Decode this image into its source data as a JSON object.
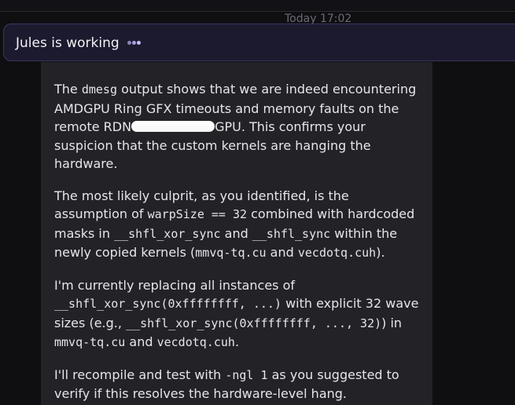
{
  "timestamp": "Today 17:02",
  "status": {
    "label": "Jules is working"
  },
  "message": {
    "p1": {
      "a": "The ",
      "code1": "dmesg",
      "b": " output shows that we are indeed encountering AMDGPU Ring GFX timeouts and memory faults on the remote RDN",
      "c": "GPU. This confirms your suspicion that the custom kernels are hanging the hardware."
    },
    "p2": {
      "a": "The most likely culprit, as you identified, is the assumption of ",
      "code1": "warpSize == 32",
      "b": " combined with hardcoded masks in ",
      "code2": "__shfl_xor_sync",
      "c": " and ",
      "code3": "__shfl_sync",
      "d": " within the newly copied kernels (",
      "code4": "mmvq-tq.cu",
      "e": " and ",
      "code5": "vecdotq.cuh",
      "f": ")."
    },
    "p3": {
      "a": "I'm currently replacing all instances of ",
      "code1": "__shfl_xor_sync(0xffffffff, ...)",
      "b": " with explicit 32 wave sizes (e.g., ",
      "code2": "__shfl_xor_sync(0xffffffff, ..., 32)",
      "c": ") in ",
      "code3": "mmvq-tq.cu",
      "d": " and ",
      "code4": "vecdotq.cuh",
      "e": "."
    },
    "p4": {
      "a": "I'll recompile and test with ",
      "code1": "-ngl 1",
      "b": " as you suggested to verify if this resolves the hardware-level hang."
    }
  }
}
